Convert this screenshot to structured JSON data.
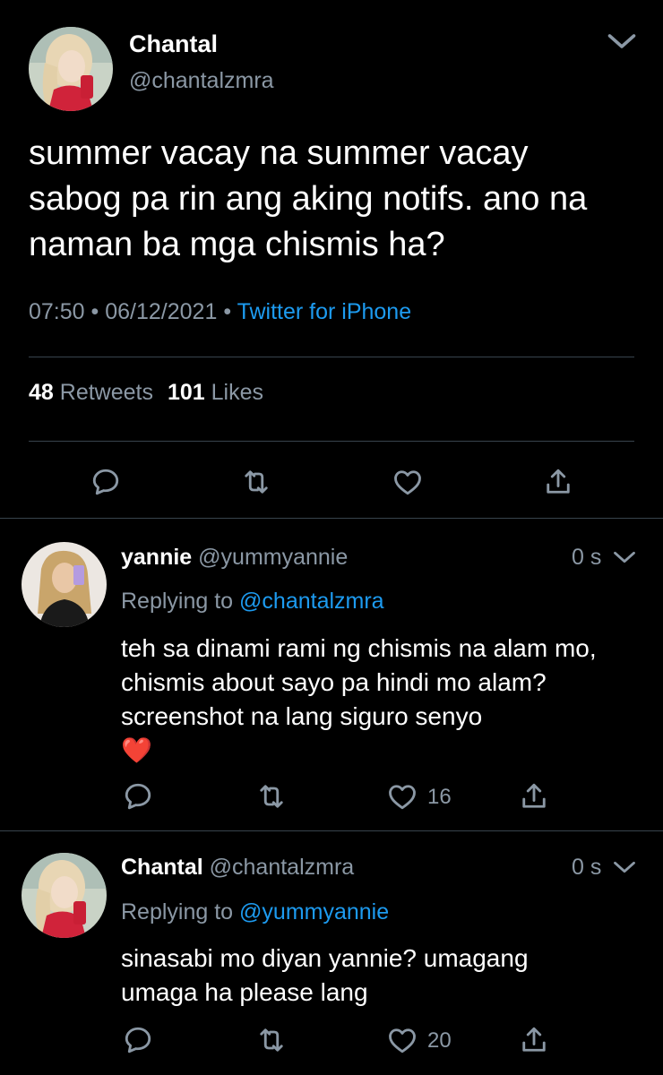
{
  "main_tweet": {
    "display_name": "Chantal",
    "handle": "@chantalzmra",
    "text": "summer vacay na summer vacay\nsabog pa rin ang aking notifs. ano na\nnaman ba mga chismis ha?",
    "time": "07:50",
    "date": "06/12/2021",
    "source": "Twitter for iPhone",
    "separator": "•",
    "retweets_count": "48",
    "retweets_label": "Retweets",
    "likes_count": "101",
    "likes_label": "Likes"
  },
  "replies": [
    {
      "display_name": "yannie",
      "handle": "@yummyannie",
      "time": "0 s",
      "replying_prefix": "Replying to",
      "replying_to": "@chantalzmra",
      "text": "teh sa dinami rami ng chismis na alam mo, chismis about sayo pa hindi mo alam? screenshot na lang siguro senyo",
      "emoji": "❤️",
      "likes_count": "16"
    },
    {
      "display_name": "Chantal",
      "handle": "@chantalzmra",
      "time": "0 s",
      "replying_prefix": "Replying to",
      "replying_to": "@yummyannie",
      "text": "sinasabi mo diyan yannie? umagang umaga ha please lang",
      "likes_count": "20"
    }
  ],
  "colors": {
    "background": "#000000",
    "primary_text": "#ffffff",
    "secondary_text": "#8b98a5",
    "accent": "#1d9bf0",
    "divider": "#38444d"
  },
  "icons": [
    "chevron-down-icon",
    "reply-icon",
    "retweet-icon",
    "like-icon",
    "share-icon",
    "heart-emoji"
  ]
}
